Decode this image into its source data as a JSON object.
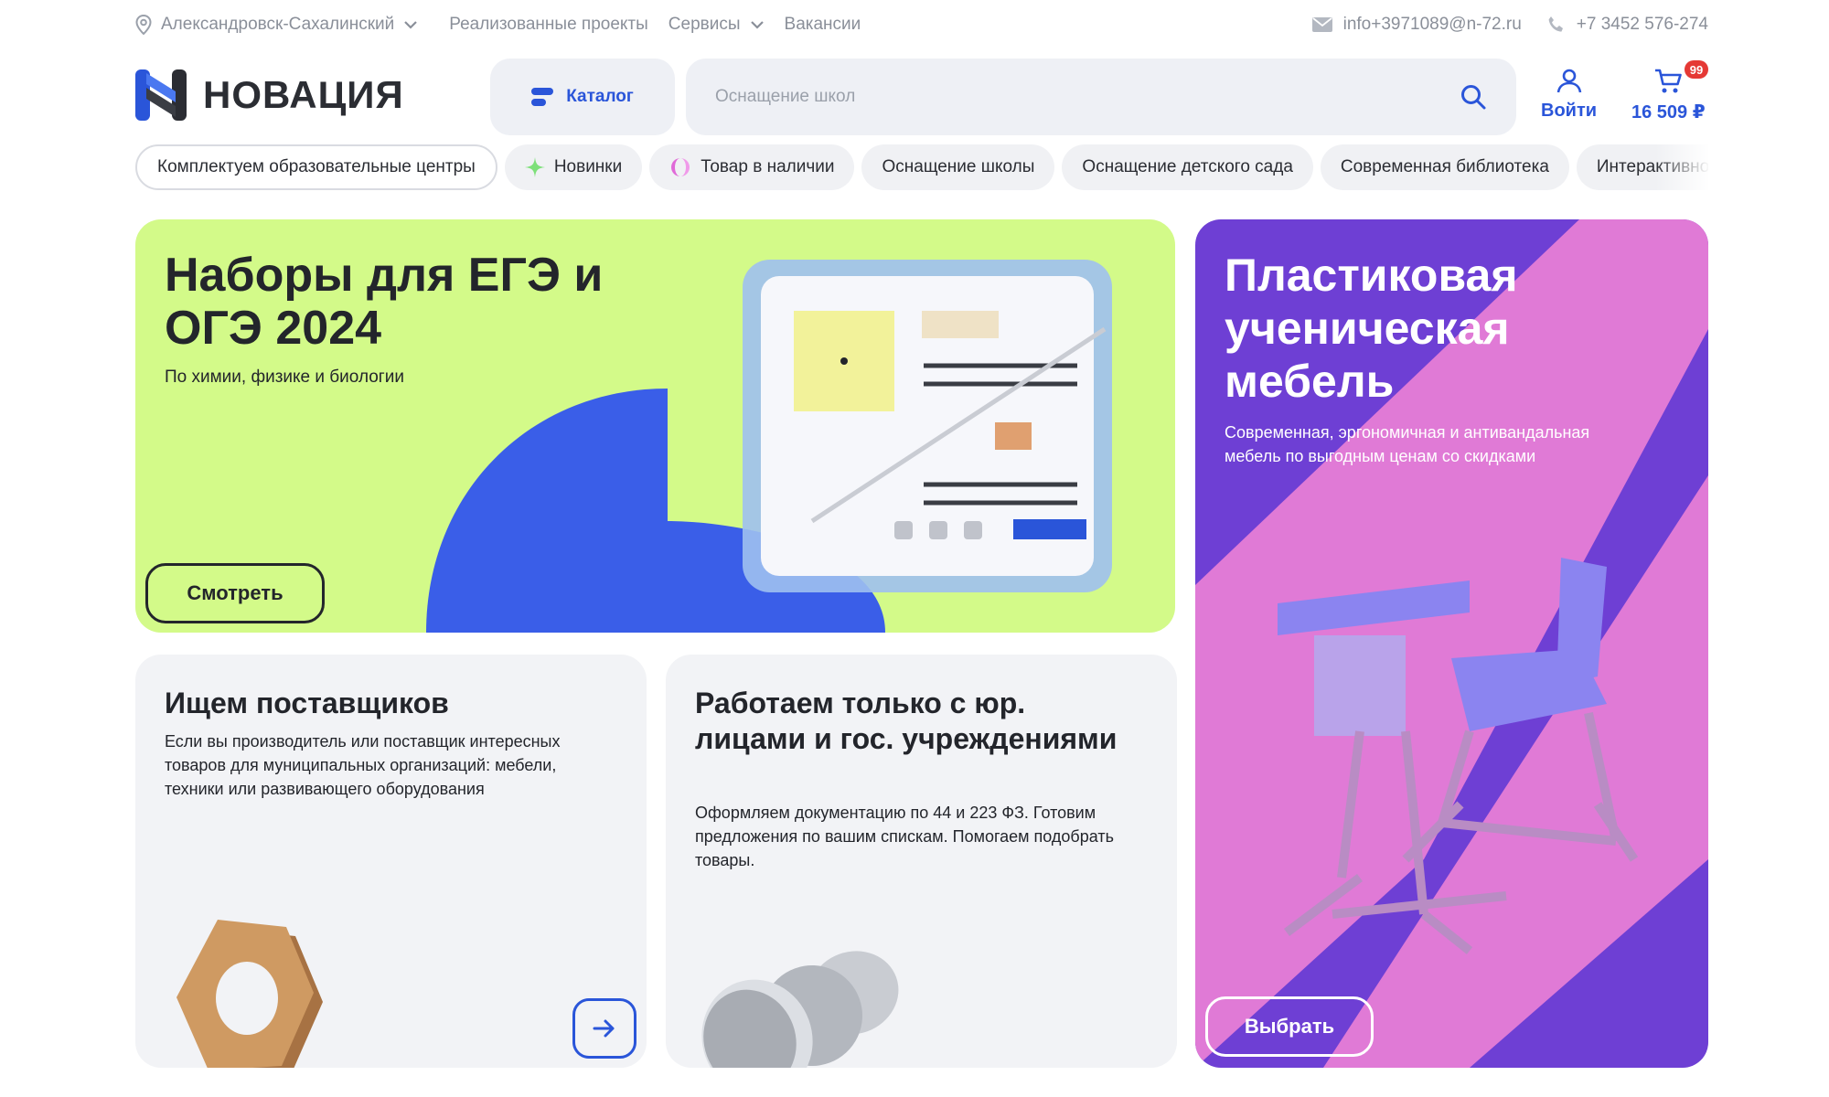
{
  "topbar": {
    "city": "Александровск-Сахалинский",
    "links": [
      "Реализованные проекты",
      "Сервисы",
      "Вакансии"
    ],
    "email": "info+3971089@n-72.ru",
    "phone": "+7 3452 576-274"
  },
  "header": {
    "logo_text": "НОВАЦИЯ",
    "catalog_label": "Каталог",
    "search_placeholder": "Оснащение школ",
    "login_label": "Войти",
    "cart_total": "16 509 ₽",
    "cart_badge": "99"
  },
  "chips": [
    "Комплектуем образовательные центры",
    "Новинки",
    "Товар в наличии",
    "Оснащение школы",
    "Оснащение детского сада",
    "Современная библиотека",
    "Интерактивное"
  ],
  "banners": {
    "ege": {
      "title": "Наборы для ЕГЭ и ОГЭ 2024",
      "subtitle": "По химии, физике и биологии",
      "button": "Смотреть"
    },
    "furniture": {
      "title": "Пластиковая ученическая мебель",
      "subtitle": "Современная, эргономичная и антивандальная мебель по выгодным ценам со скидками",
      "button": "Выбрать"
    },
    "suppliers": {
      "title": "Ищем поставщиков",
      "subtitle": "Если вы производитель или поставщик интересных товаров для муниципальных организаций: мебели, техники или развивающего оборудования"
    },
    "work": {
      "title": "Работаем только с юр. лицами и гос. учреждениями",
      "subtitle": "Оформляем документацию по 44 и 223 ФЗ. Готовим предложения по вашим спискам. Помогаем подобрать товары."
    }
  },
  "colors": {
    "accent": "#2a55d9",
    "lime": "#d3fa89",
    "purple": "#6e3fd4",
    "pink": "#e07ad6",
    "badge": "#e53935"
  },
  "icons": {
    "location": "location-pin-icon",
    "chevron": "chevron-down-icon",
    "mail": "mail-icon",
    "phone": "phone-icon",
    "search": "search-icon",
    "user": "user-icon",
    "cart": "cart-icon",
    "arrow": "arrow-right-icon"
  }
}
